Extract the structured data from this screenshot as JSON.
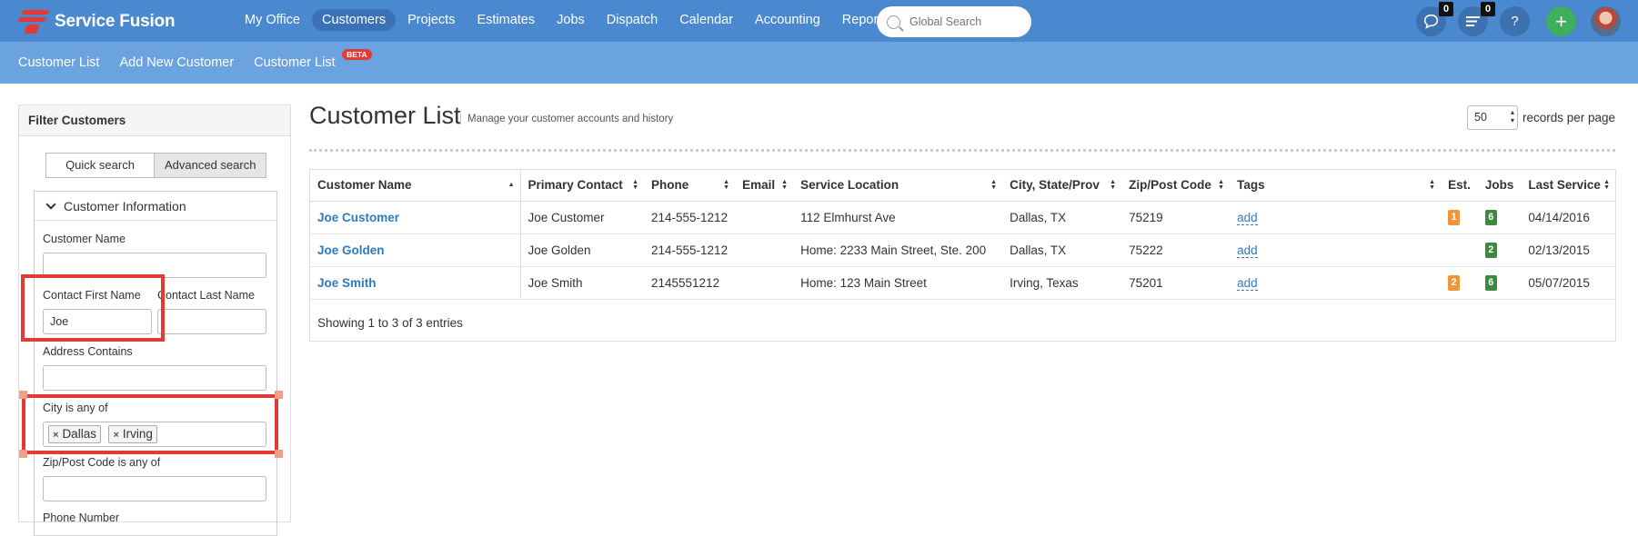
{
  "app": {
    "brand": "Service Fusion",
    "brand_color": "#e53935",
    "topbar_color": "#4a88cf",
    "subbar_color": "#6aa3e0"
  },
  "nav": {
    "items": [
      {
        "label": "My Office",
        "active": false
      },
      {
        "label": "Customers",
        "active": true
      },
      {
        "label": "Projects",
        "active": false
      },
      {
        "label": "Estimates",
        "active": false
      },
      {
        "label": "Jobs",
        "active": false
      },
      {
        "label": "Dispatch",
        "active": false
      },
      {
        "label": "Calendar",
        "active": false
      },
      {
        "label": "Accounting",
        "active": false
      },
      {
        "label": "Reports",
        "active": false
      }
    ],
    "search_placeholder": "Global Search",
    "chat_count": "0",
    "tasks_count": "0",
    "help_label": "?",
    "add_label": "+"
  },
  "subnav": {
    "items": [
      "Customer List",
      "Add New Customer",
      "Customer List"
    ],
    "beta_label": "BETA"
  },
  "filter": {
    "title": "Filter Customers",
    "quick_search": "Quick search",
    "advanced_search": "Advanced search",
    "section_title": "Customer Information",
    "customer_name_label": "Customer Name",
    "customer_name_value": "",
    "contact_first_label": "Contact First Name",
    "contact_first_value": "Joe",
    "contact_last_label": "Contact Last Name",
    "contact_last_value": "",
    "address_label": "Address Contains",
    "address_value": "",
    "city_label": "City is any of",
    "city_tags": [
      "Dallas",
      "Irving"
    ],
    "zip_label": "Zip/Post Code is any of",
    "zip_value": "",
    "phone_label": "Phone Number"
  },
  "main": {
    "title": "Customer List",
    "subtitle": "Manage your customer accounts and history",
    "records_value": "50",
    "records_label": "records per page",
    "columns": [
      "Customer Name",
      "Primary Contact",
      "Phone",
      "Email",
      "Service Location",
      "City, State/Prov",
      "Zip/Post Code",
      "Tags",
      "Est.",
      "Jobs",
      "Last Service"
    ],
    "rows": [
      {
        "name": "Joe Customer",
        "contact": "Joe Customer",
        "phone": "214-555-1212",
        "email": "",
        "location": "112 Elmhurst Ave",
        "city": "Dallas, TX",
        "zip": "75219",
        "tags": "add",
        "est": "1",
        "jobs": "6",
        "last": "04/14/2016"
      },
      {
        "name": "Joe Golden",
        "contact": "Joe Golden",
        "phone": "214-555-1212",
        "email": "",
        "location": "Home: 2233 Main Street, Ste. 200",
        "city": "Dallas, TX",
        "zip": "75222",
        "tags": "add",
        "est": "",
        "jobs": "2",
        "last": "02/13/2015"
      },
      {
        "name": "Joe Smith",
        "contact": "Joe Smith",
        "phone": "2145551212",
        "email": "",
        "location": "Home: 123 Main Street",
        "city": "Irving, Texas",
        "zip": "75201",
        "tags": "add",
        "est": "2",
        "jobs": "6",
        "last": "05/07/2015"
      }
    ],
    "footer": "Showing 1 to 3 of 3 entries"
  }
}
